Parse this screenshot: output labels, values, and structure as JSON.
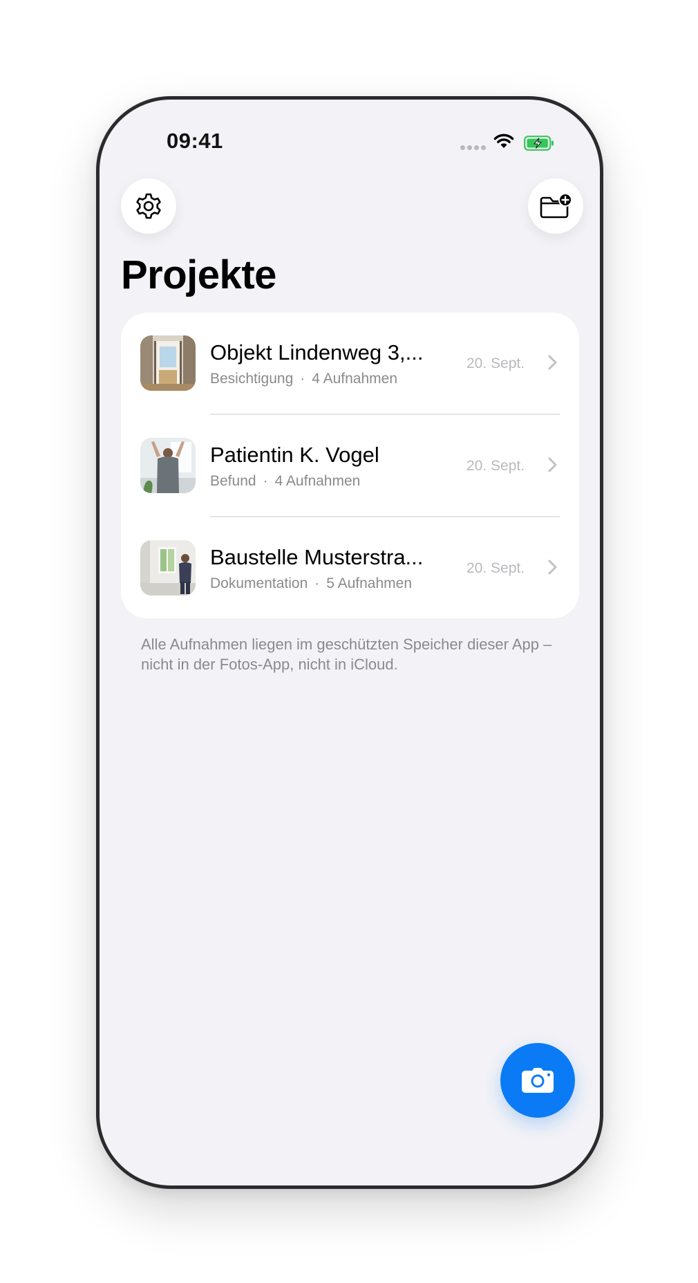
{
  "status_bar": {
    "time": "09:41",
    "signal_icon": "cellular-signal-icon",
    "wifi_icon": "wifi-icon",
    "battery_icon": "battery-charging-icon",
    "battery_color": "#34c759"
  },
  "toolbar": {
    "settings_icon": "gear-icon",
    "new_project_icon": "folder-plus-icon"
  },
  "page": {
    "title": "Projekte"
  },
  "projects": [
    {
      "name": "Objekt Lindenweg 3,...",
      "category": "Besichtigung",
      "separator": "·",
      "count": "4 Aufnahmen",
      "date": "20. Sept."
    },
    {
      "name": "Patientin K. Vogel",
      "category": "Befund",
      "separator": "·",
      "count": "4 Aufnahmen",
      "date": "20. Sept."
    },
    {
      "name": "Baustelle Musterstra...",
      "category": "Dokumentation",
      "separator": "·",
      "count": "5 Aufnahmen",
      "date": "20. Sept."
    }
  ],
  "footer": {
    "note": "Alle Aufnahmen liegen im geschützten Speicher dieser App – nicht in der Fotos-App, nicht in iCloud."
  },
  "fab": {
    "icon": "camera-icon",
    "color": "#0a7bf5"
  }
}
